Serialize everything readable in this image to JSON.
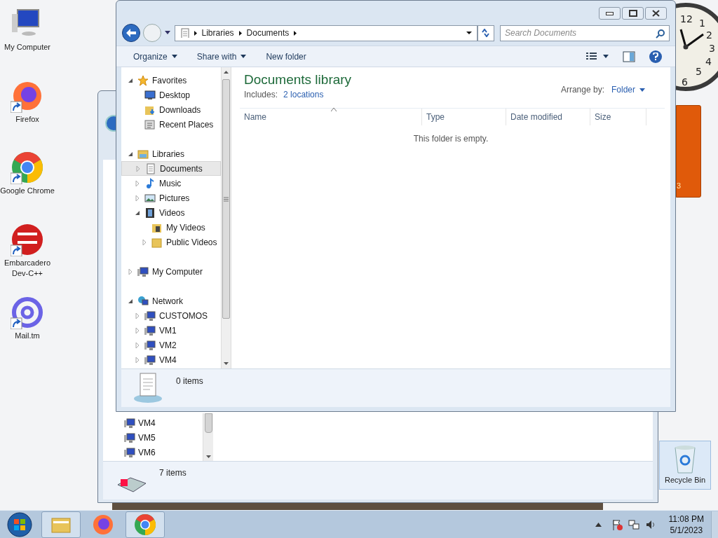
{
  "desktop_icons": [
    {
      "label": "My Computer",
      "kind": "computer",
      "shortcut": false
    },
    {
      "label": "Firefox",
      "kind": "firefox",
      "shortcut": true
    },
    {
      "label": "Google Chrome",
      "kind": "chrome",
      "shortcut": true
    },
    {
      "label": "Embarcadero Dev-C++",
      "kind": "devcpp",
      "shortcut": true
    },
    {
      "label": "Mail.tm",
      "kind": "mail",
      "shortcut": true
    }
  ],
  "recycle_bin": {
    "label": "Recycle Bin",
    "selected": true
  },
  "clock_gadget": {
    "numerals": [
      "12",
      "1",
      "2",
      "3",
      "4",
      "5",
      "6"
    ]
  },
  "notes_gadget": {
    "text": "3"
  },
  "back_window": {
    "nav_items": [
      "VM4",
      "VM5",
      "VM6"
    ],
    "status": "7 items"
  },
  "window": {
    "address": [
      "Libraries",
      "Documents"
    ],
    "search": {
      "placeholder": "Search Documents"
    },
    "toolbar": [
      {
        "label": "Organize",
        "dropdown": true
      },
      {
        "label": "Share with",
        "dropdown": true
      },
      {
        "label": "New folder",
        "dropdown": false
      }
    ],
    "nav_tree": [
      {
        "label": "Favorites",
        "kind": "star",
        "expanded": true,
        "selected": false,
        "children": [
          {
            "label": "Desktop",
            "kind": "desktop",
            "selected": false
          },
          {
            "label": "Downloads",
            "kind": "downloads",
            "selected": false
          },
          {
            "label": "Recent Places",
            "kind": "recent",
            "selected": false
          }
        ]
      },
      {
        "label": "Libraries",
        "kind": "library",
        "expanded": true,
        "selected": false,
        "children": [
          {
            "label": "Documents",
            "kind": "document",
            "expanded": false,
            "selected": true
          },
          {
            "label": "Music",
            "kind": "music",
            "expanded": false,
            "selected": false
          },
          {
            "label": "Pictures",
            "kind": "pictures",
            "expanded": false,
            "selected": false
          },
          {
            "label": "Videos",
            "kind": "videos",
            "expanded": true,
            "selected": false,
            "children": [
              {
                "label": "My Videos",
                "kind": "videofolder",
                "selected": false
              },
              {
                "label": "Public Videos",
                "kind": "folder",
                "expanded": false,
                "selected": false
              }
            ]
          }
        ]
      },
      {
        "label": "My Computer",
        "kind": "computer",
        "expanded": false,
        "selected": false
      },
      {
        "label": "Network",
        "kind": "network",
        "expanded": true,
        "selected": false,
        "children": [
          {
            "label": "CUSTOMOS",
            "kind": "computer",
            "expanded": false,
            "selected": false
          },
          {
            "label": "VM1",
            "kind": "computer",
            "expanded": false,
            "selected": false
          },
          {
            "label": "VM2",
            "kind": "computer",
            "expanded": false,
            "selected": false
          },
          {
            "label": "VM4",
            "kind": "computer",
            "expanded": false,
            "selected": false
          }
        ]
      }
    ],
    "library": {
      "title": "Documents library",
      "includes_label": "Includes:",
      "includes_link": "2 locations",
      "arrange_label": "Arrange by:",
      "arrange_value": "Folder"
    },
    "columns": [
      {
        "label": "Name",
        "sorted": true
      },
      {
        "label": "Type",
        "sorted": false
      },
      {
        "label": "Date modified",
        "sorted": false
      },
      {
        "label": "Size",
        "sorted": false
      }
    ],
    "empty_message": "This folder is empty.",
    "status": "0 items"
  },
  "taskbar": {
    "apps": [
      {
        "kind": "explorer",
        "running": true
      },
      {
        "kind": "firefox",
        "running": false
      },
      {
        "kind": "chrome",
        "running": true
      }
    ],
    "time": "11:08 PM",
    "date": "5/1/2023"
  }
}
